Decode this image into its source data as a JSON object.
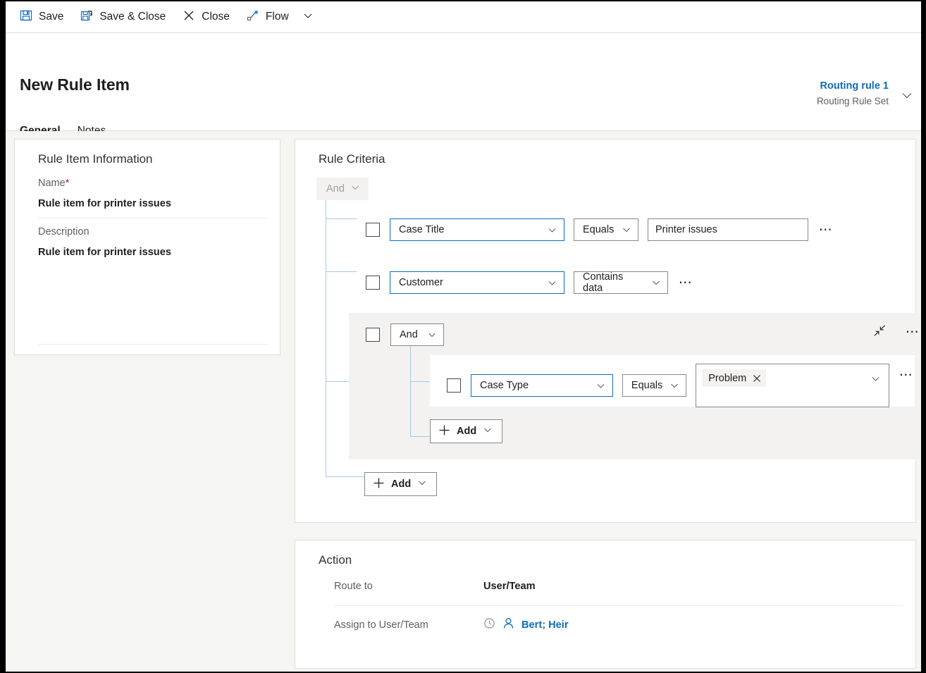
{
  "commandbar": {
    "buttons": [
      {
        "label": "Save",
        "icon": "save-icon"
      },
      {
        "label": "Save & Close",
        "icon": "save-and-close-icon"
      },
      {
        "label": "Close",
        "icon": "close-x-icon"
      },
      {
        "label": "Flow",
        "icon": "flow-icon"
      }
    ],
    "overflow_icon": "chevron-down-icon"
  },
  "header": {
    "title": "New Rule Item",
    "right_primary": "Routing rule 1",
    "right_secondary": "Routing Rule Set",
    "expand_icon": "chevron-down-icon",
    "tabs": [
      {
        "label": "General",
        "active": true
      },
      {
        "label": "Notes",
        "active": false
      }
    ]
  },
  "rule_item_information": {
    "title": "Rule Item Information",
    "name_label": "Name",
    "name_required": "*",
    "name_value": "Rule item for printer issues",
    "description_label": "Description",
    "description_value": "Rule item for printer issues"
  },
  "rule_criteria": {
    "title": "Rule Criteria",
    "root_operator": "And",
    "root_operator_icon": "chevron-down-icon",
    "rows": [
      {
        "field": "Case Title",
        "operator": "Equals",
        "value": "Printer issues",
        "more_icon": "ellipsis-icon"
      },
      {
        "field": "Customer",
        "operator": "Contains data",
        "more_icon": "ellipsis-icon"
      }
    ],
    "group": {
      "operator": "And",
      "operator_icon": "chevron-down-icon",
      "collapse_icon": "collapse-icon",
      "more_icon": "ellipsis-icon",
      "row": {
        "field": "Case Type",
        "operator": "Equals",
        "value_chip": "Problem",
        "chip_remove_icon": "close-x-icon",
        "value_chevron_icon": "chevron-down-icon",
        "more_icon": "ellipsis-icon"
      },
      "add_label": "Add",
      "add_plus_icon": "plus-icon",
      "add_chevron_icon": "chevron-down-icon"
    },
    "add_label": "Add",
    "add_plus_icon": "plus-icon",
    "add_chevron_icon": "chevron-down-icon"
  },
  "action": {
    "title": "Action",
    "route_to_label": "Route to",
    "route_to_value": "User/Team",
    "assign_label": "Assign to User/Team",
    "assign_recent_icon": "recent-clock-icon",
    "assign_person_icon": "person-icon",
    "assign_value": "Bert; Heir"
  },
  "colors": {
    "accent_blue": "#0f6cbd",
    "tree_line": "#a9c6ec",
    "group_bg": "#f3f2f1",
    "page_bg": "#f5f5f3",
    "required_red": "#a4262c",
    "border_gray": "#8a8886"
  }
}
